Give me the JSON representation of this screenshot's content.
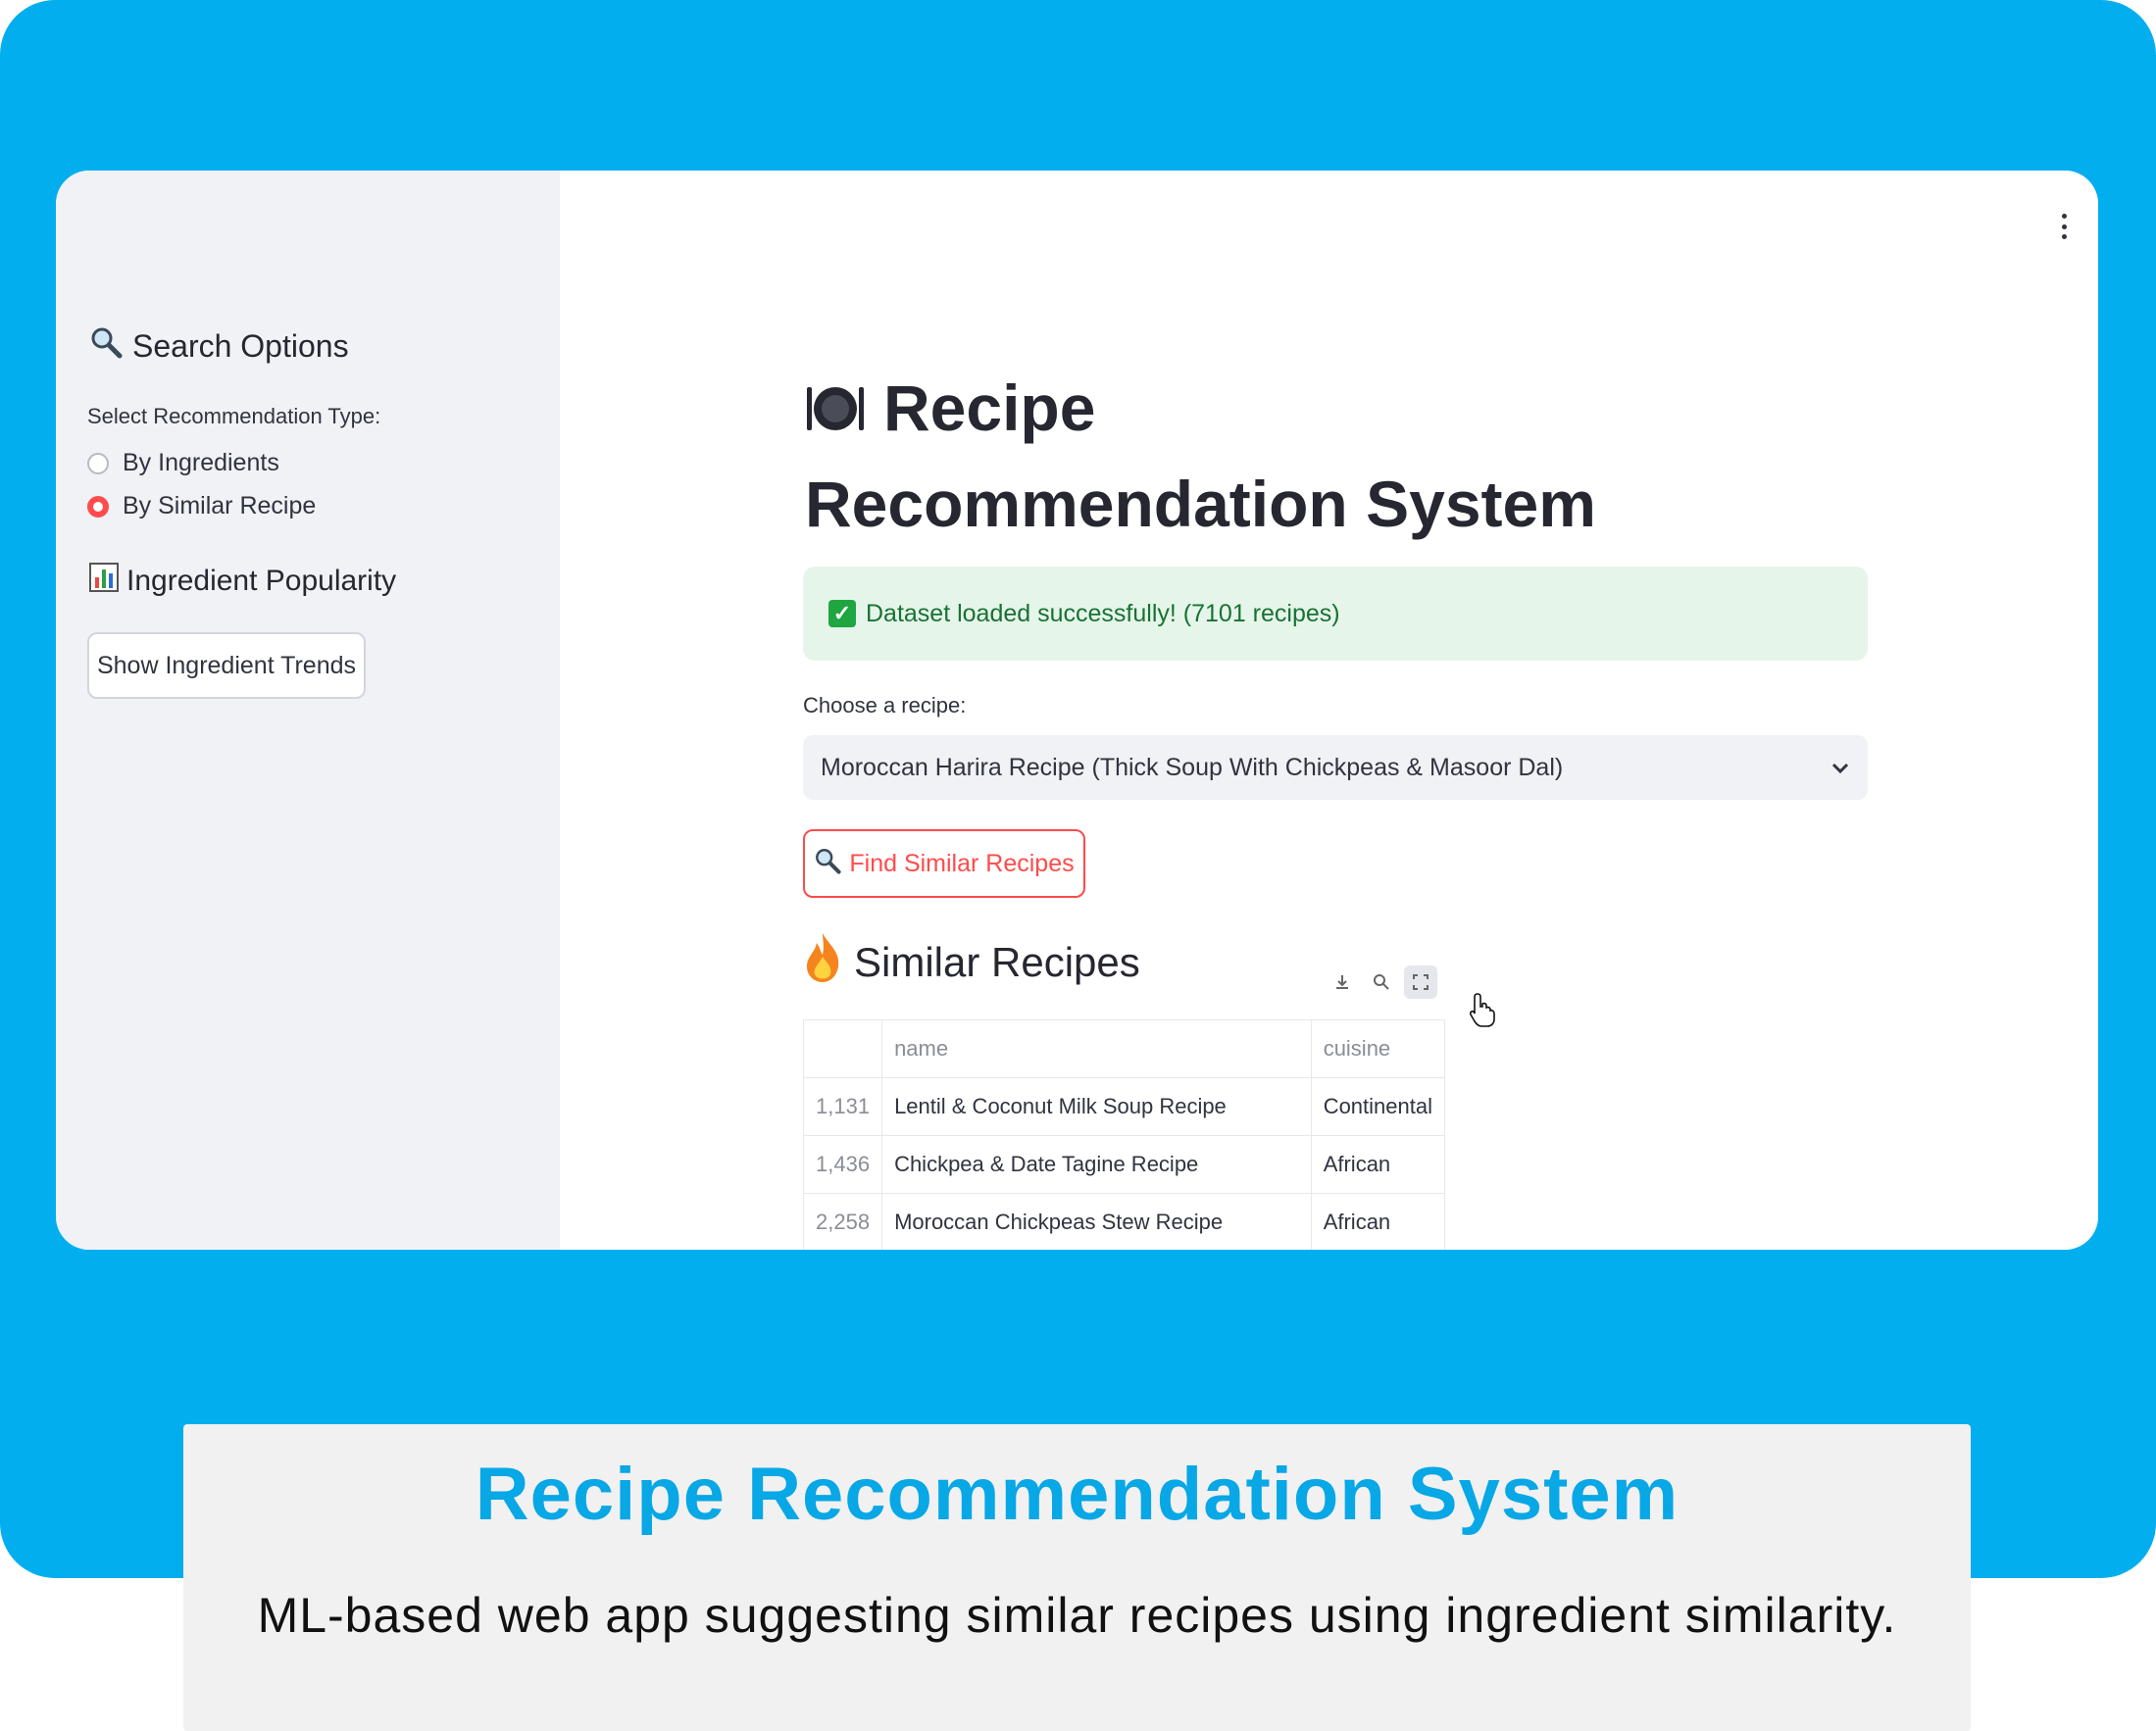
{
  "sidebar": {
    "search_header": "Search Options",
    "type_label": "Select Recommendation Type:",
    "options": [
      {
        "label": "By Ingredients",
        "selected": false
      },
      {
        "label": "By Similar Recipe",
        "selected": true
      }
    ],
    "popularity_header": "Ingredient Popularity",
    "trends_button": "Show Ingredient Trends"
  },
  "main": {
    "title": "Recipe Recommendation System",
    "success_message": "Dataset loaded successfully! (7101 recipes)",
    "choose_label": "Choose a recipe:",
    "selected_recipe": "Moroccan Harira Recipe (Thick Soup With Chickpeas & Masoor Dal)",
    "find_button": "Find Similar Recipes",
    "similar_header": "Similar Recipes",
    "table": {
      "columns": [
        "name",
        "cuisine"
      ],
      "rows": [
        {
          "index": "1,131",
          "name": "Lentil & Coconut Milk Soup Recipe",
          "cuisine": "Continental"
        },
        {
          "index": "1,436",
          "name": "Chickpea & Date Tagine Recipe",
          "cuisine": "African"
        },
        {
          "index": "2,258",
          "name": "Moroccan Chickpeas Stew Recipe",
          "cuisine": "African"
        }
      ]
    }
  },
  "caption": {
    "title": "Recipe Recommendation System",
    "subtitle": "ML-based web app suggesting similar recipes using ingredient similarity."
  },
  "colors": {
    "background": "#03aeef",
    "accent": "#ff4b4b",
    "caption_title": "#08a7e6",
    "success_bg": "#e6f5ea"
  }
}
